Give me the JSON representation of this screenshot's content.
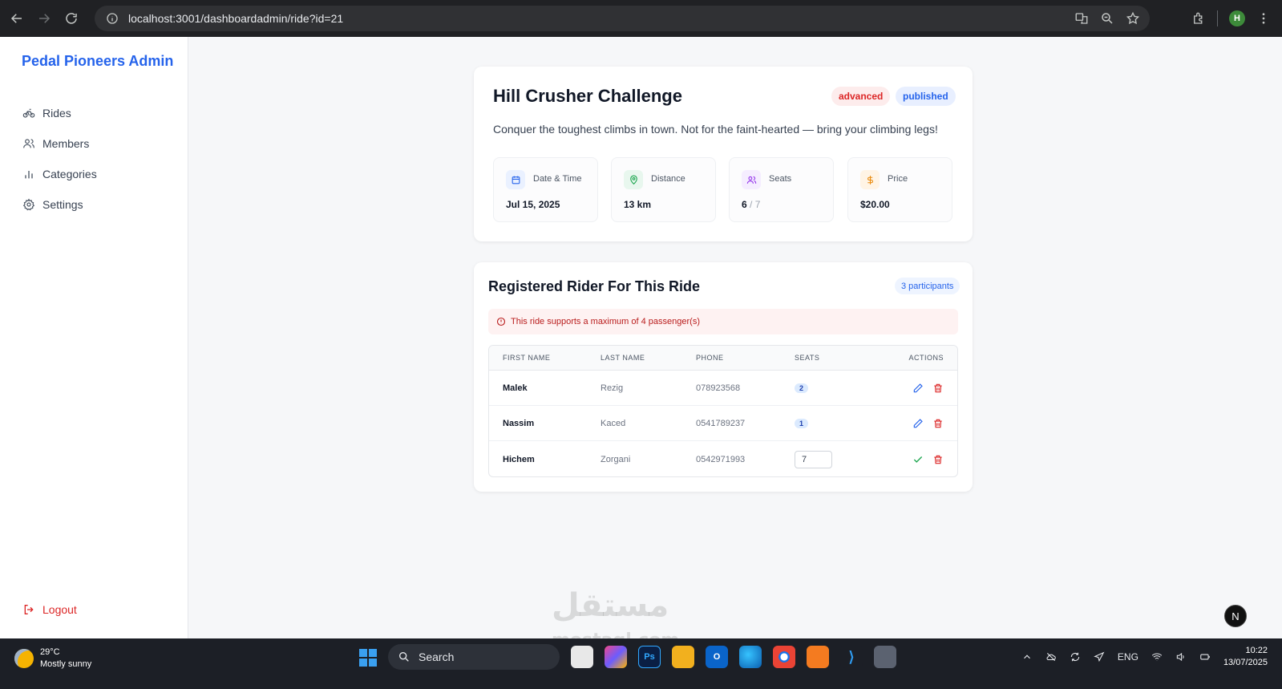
{
  "browser": {
    "url": "localhost:3001/dashboardadmin/ride?id=21",
    "profile_initial": "H"
  },
  "sidebar": {
    "brand": "Pedal Pioneers Admin",
    "items": [
      {
        "label": "Rides",
        "icon": "bike-icon"
      },
      {
        "label": "Members",
        "icon": "users-icon"
      },
      {
        "label": "Categories",
        "icon": "bar-chart-icon"
      },
      {
        "label": "Settings",
        "icon": "gear-icon"
      }
    ],
    "logout": "Logout"
  },
  "ride": {
    "title": "Hill Crusher Challenge",
    "level": "advanced",
    "status": "published",
    "description": "Conquer the toughest climbs in town. Not for the faint-hearted — bring your climbing legs!",
    "stats": {
      "date": {
        "label": "Date & Time",
        "value": "Jul 15, 2025"
      },
      "distance": {
        "label": "Distance",
        "value": "13 km"
      },
      "seats": {
        "label": "Seats",
        "taken": "6",
        "total": "/ 7"
      },
      "price": {
        "label": "Price",
        "value": "$20.00"
      }
    }
  },
  "riders": {
    "title": "Registered Rider For This Ride",
    "count": "3 participants",
    "alert": "This ride supports a maximum of 4 passenger(s)",
    "columns": {
      "first": "FIRST NAME",
      "last": "LAST NAME",
      "phone": "PHONE",
      "seats": "SEATS",
      "actions": "ACTIONS"
    },
    "rows": [
      {
        "first": "Malek",
        "last": "Rezig",
        "phone": "078923568",
        "seats": "2"
      },
      {
        "first": "Nassim",
        "last": "Kaced",
        "phone": "0541789237",
        "seats": "1"
      },
      {
        "first": "Hichem",
        "last": "Zorgani",
        "phone": "0542971993",
        "seats": "7"
      }
    ]
  },
  "watermark": {
    "arabic": "مستقل",
    "latin": "mostaql.com"
  },
  "next_badge": "N",
  "taskbar": {
    "temperature": "29°C",
    "weather": "Mostly sunny",
    "search": "Search",
    "language": "ENG",
    "time": "10:22",
    "date": "13/07/2025"
  }
}
